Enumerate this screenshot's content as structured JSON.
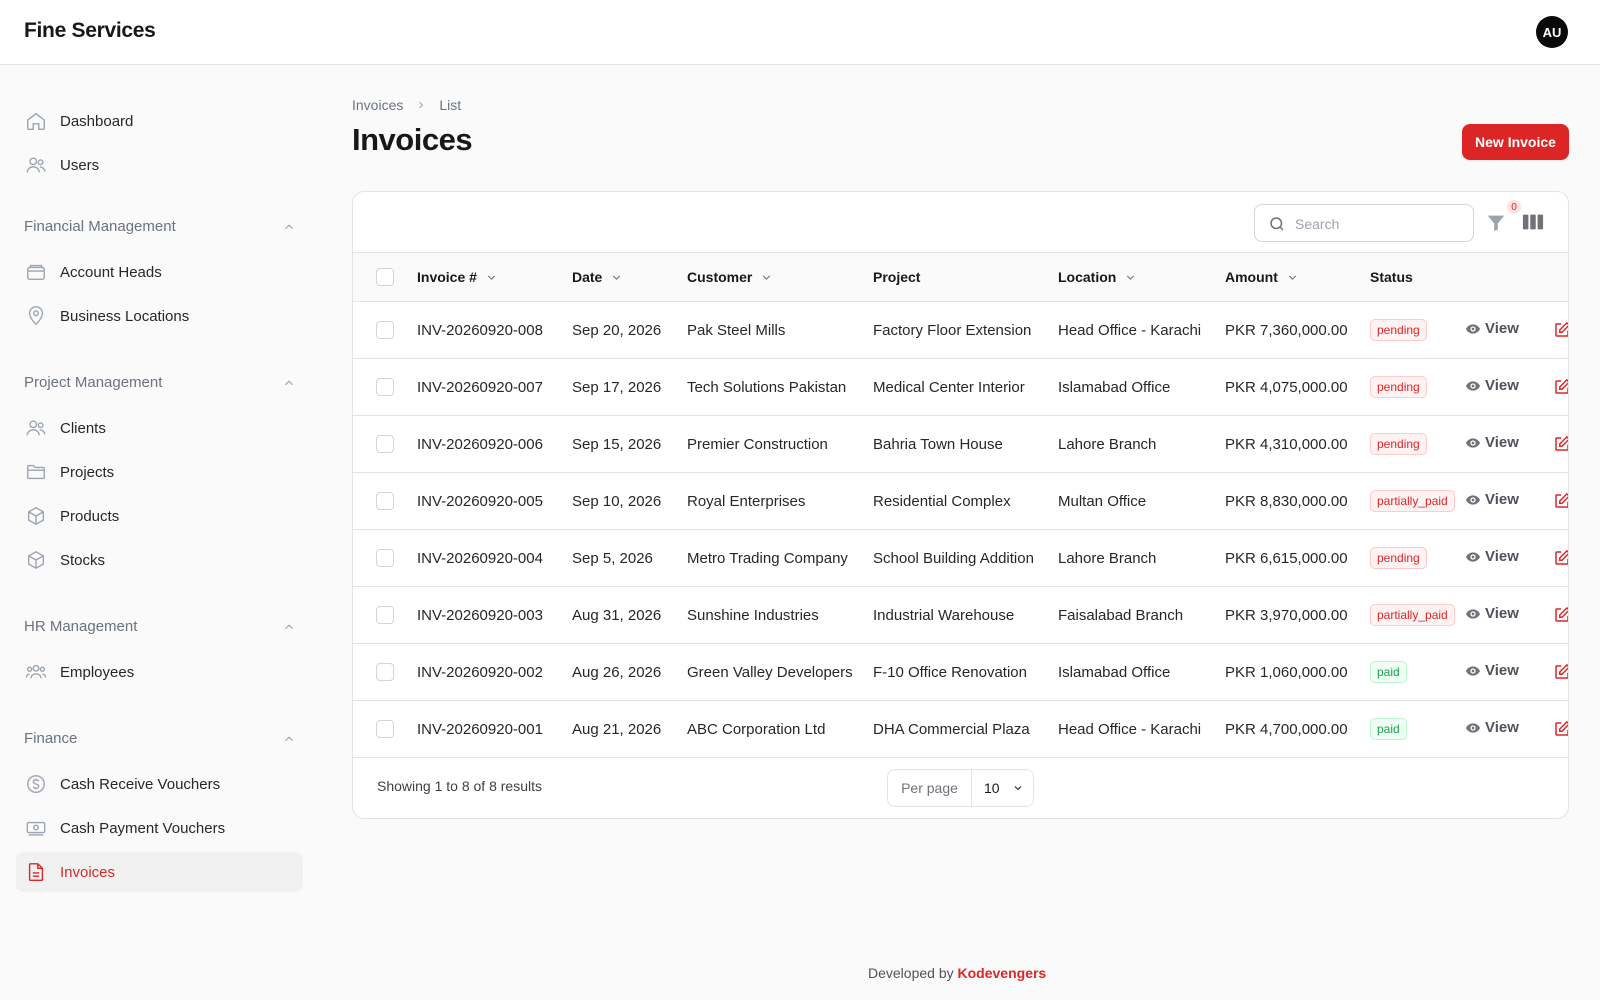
{
  "app": {
    "brand": "Fine Services",
    "avatar_initials": "AU"
  },
  "sidebar": {
    "top_items": [
      {
        "label": "Dashboard",
        "icon": "home-icon"
      },
      {
        "label": "Users",
        "icon": "users-icon"
      }
    ],
    "groups": [
      {
        "label": "Financial Management",
        "items": [
          {
            "label": "Account Heads",
            "icon": "wallet-icon"
          },
          {
            "label": "Business Locations",
            "icon": "map-pin-icon"
          }
        ]
      },
      {
        "label": "Project Management",
        "items": [
          {
            "label": "Clients",
            "icon": "users-icon"
          },
          {
            "label": "Projects",
            "icon": "folder-icon"
          },
          {
            "label": "Products",
            "icon": "cube-icon"
          },
          {
            "label": "Stocks",
            "icon": "cube-icon"
          }
        ]
      },
      {
        "label": "HR Management",
        "items": [
          {
            "label": "Employees",
            "icon": "user-group-icon"
          }
        ]
      },
      {
        "label": "Finance",
        "items": [
          {
            "label": "Cash Receive Vouchers",
            "icon": "dollar-circle-icon"
          },
          {
            "label": "Cash Payment Vouchers",
            "icon": "banknotes-icon"
          },
          {
            "label": "Invoices",
            "icon": "document-icon",
            "active": true
          }
        ]
      }
    ]
  },
  "breadcrumb": {
    "parent": "Invoices",
    "current": "List"
  },
  "page": {
    "title": "Invoices",
    "new_button": "New Invoice"
  },
  "toolbar": {
    "search_placeholder": "Search",
    "filter_count": "0"
  },
  "table": {
    "columns": [
      {
        "label": "Invoice #",
        "sortable": true
      },
      {
        "label": "Date",
        "sortable": true
      },
      {
        "label": "Customer",
        "sortable": true
      },
      {
        "label": "Project",
        "sortable": false
      },
      {
        "label": "Location",
        "sortable": true
      },
      {
        "label": "Amount",
        "sortable": true
      },
      {
        "label": "Status",
        "sortable": false
      }
    ],
    "view_label": "View",
    "rows": [
      {
        "invoice": "INV-20260920-008",
        "date": "Sep 20, 2026",
        "customer": "Pak Steel Mills",
        "project": "Factory Floor Extension",
        "location": "Head Office - Karachi",
        "amount": "PKR 7,360,000.00",
        "status": "pending"
      },
      {
        "invoice": "INV-20260920-007",
        "date": "Sep 17, 2026",
        "customer": "Tech Solutions Pakistan",
        "project": "Medical Center Interior",
        "location": "Islamabad Office",
        "amount": "PKR 4,075,000.00",
        "status": "pending"
      },
      {
        "invoice": "INV-20260920-006",
        "date": "Sep 15, 2026",
        "customer": "Premier Construction",
        "project": "Bahria Town House",
        "location": "Lahore Branch",
        "amount": "PKR 4,310,000.00",
        "status": "pending"
      },
      {
        "invoice": "INV-20260920-005",
        "date": "Sep 10, 2026",
        "customer": "Royal Enterprises",
        "project": "Residential Complex",
        "location": "Multan Office",
        "amount": "PKR 8,830,000.00",
        "status": "partially_paid"
      },
      {
        "invoice": "INV-20260920-004",
        "date": "Sep 5, 2026",
        "customer": "Metro Trading Company",
        "project": "School Building Addition",
        "location": "Lahore Branch",
        "amount": "PKR 6,615,000.00",
        "status": "pending"
      },
      {
        "invoice": "INV-20260920-003",
        "date": "Aug 31, 2026",
        "customer": "Sunshine Industries",
        "project": "Industrial Warehouse",
        "location": "Faisalabad Branch",
        "amount": "PKR 3,970,000.00",
        "status": "partially_paid"
      },
      {
        "invoice": "INV-20260920-002",
        "date": "Aug 26, 2026",
        "customer": "Green Valley Developers",
        "project": "F-10 Office Renovation",
        "location": "Islamabad Office",
        "amount": "PKR 1,060,000.00",
        "status": "paid"
      },
      {
        "invoice": "INV-20260920-001",
        "date": "Aug 21, 2026",
        "customer": "ABC Corporation Ltd",
        "project": "DHA Commercial Plaza",
        "location": "Head Office - Karachi",
        "amount": "PKR 4,700,000.00",
        "status": "paid"
      }
    ]
  },
  "pagination": {
    "summary": "Showing 1 to 8 of 8 results",
    "per_page_label": "Per page",
    "per_page_value": "10"
  },
  "footer": {
    "prefix": "Developed by",
    "company": "Kodevengers"
  },
  "colors": {
    "accent": "#dc2626",
    "paid": "#16a34a"
  }
}
